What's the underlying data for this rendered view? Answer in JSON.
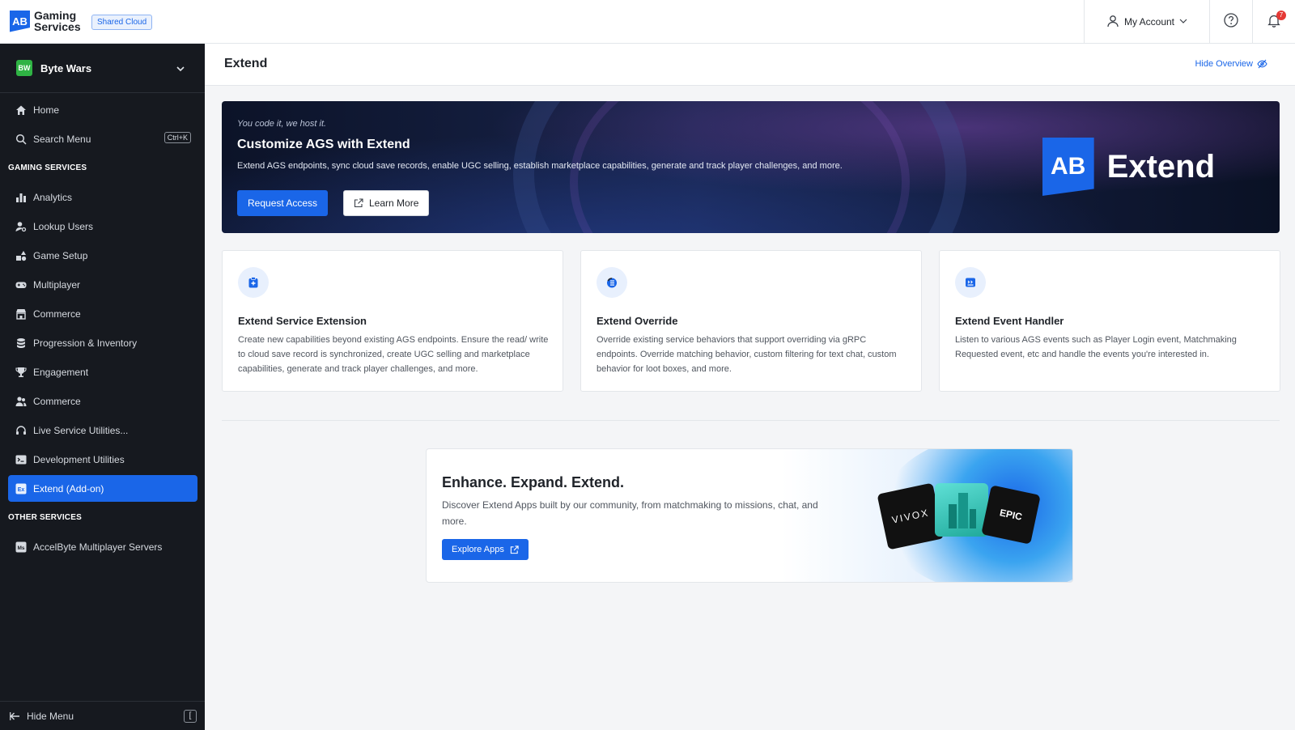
{
  "header": {
    "logo_mark": "AB",
    "logo_line1": "Gaming",
    "logo_line2": "Services",
    "environment_badge": "Shared Cloud",
    "account_label": "My Account",
    "notification_count": "7"
  },
  "sidebar": {
    "project_initials": "BW",
    "project_name": "Byte Wars",
    "search_shortcut": "Ctrl+K",
    "items_top": [
      {
        "label": "Home",
        "icon": "home-icon"
      },
      {
        "label": "Search Menu",
        "icon": "search-icon"
      }
    ],
    "section_gaming": "GAMING SERVICES",
    "items_gaming": [
      {
        "label": "Analytics",
        "icon": "bar-chart-icon"
      },
      {
        "label": "Lookup Users",
        "icon": "user-search-icon"
      },
      {
        "label": "Game Setup",
        "icon": "shapes-icon"
      },
      {
        "label": "Multiplayer",
        "icon": "gamepad-icon"
      },
      {
        "label": "Commerce",
        "icon": "store-icon"
      },
      {
        "label": "Progression & Inventory",
        "icon": "database-icon"
      },
      {
        "label": "Engagement",
        "icon": "trophy-icon"
      },
      {
        "label": "Commerce",
        "icon": "users-icon"
      },
      {
        "label": "Live Service Utilities...",
        "icon": "headset-icon"
      },
      {
        "label": "Development Utilities",
        "icon": "terminal-icon"
      },
      {
        "label": "Extend (Add-on)",
        "icon": "extend-icon",
        "active": true
      }
    ],
    "section_other": "OTHER SERVICES",
    "items_other": [
      {
        "label": "AccelByte Multiplayer Servers",
        "icon": "ms-icon"
      }
    ],
    "hide_menu_label": "Hide Menu",
    "hide_menu_key": "["
  },
  "page": {
    "title": "Extend",
    "hide_overview_label": "Hide Overview"
  },
  "hero": {
    "tagline": "You code it, we host it.",
    "title": "Customize AGS with Extend",
    "description": "Extend AGS endpoints, sync cloud save records, enable UGC selling, establish marketplace capabilities, generate and track player challenges, and more.",
    "request_access_label": "Request Access",
    "learn_more_label": "Learn More",
    "logo_mark": "AB",
    "logo_text": "Extend"
  },
  "cards": [
    {
      "title": "Extend Service Extension",
      "description": "Create new capabilities beyond existing AGS endpoints. Ensure the read/ write to cloud save record is synchronized, create UGC selling and marketplace capabilities, generate and track player challenges, and more.",
      "icon": "service-extension-icon"
    },
    {
      "title": "Extend Override",
      "description": "Override existing service behaviors that support overriding via gRPC endpoints. Override matching behavior, custom filtering for text chat, custom behavior for loot boxes, and more.",
      "icon": "override-icon"
    },
    {
      "title": "Extend Event Handler",
      "description": "Listen to various AGS events such as Player Login event, Matchmaking Requested event, etc and handle the events you're interested in.",
      "icon": "event-handler-icon"
    }
  ],
  "promo": {
    "title": "Enhance. Expand. Extend.",
    "description": "Discover Extend Apps built by our community, from matchmaking to missions, chat, and more.",
    "explore_label": "Explore Apps",
    "vivox_label": "VIVOX",
    "epic_label": "EPIC"
  },
  "colors": {
    "accent": "#1a66e8",
    "sidebar_bg": "#16191f",
    "badge_red": "#e53935"
  }
}
